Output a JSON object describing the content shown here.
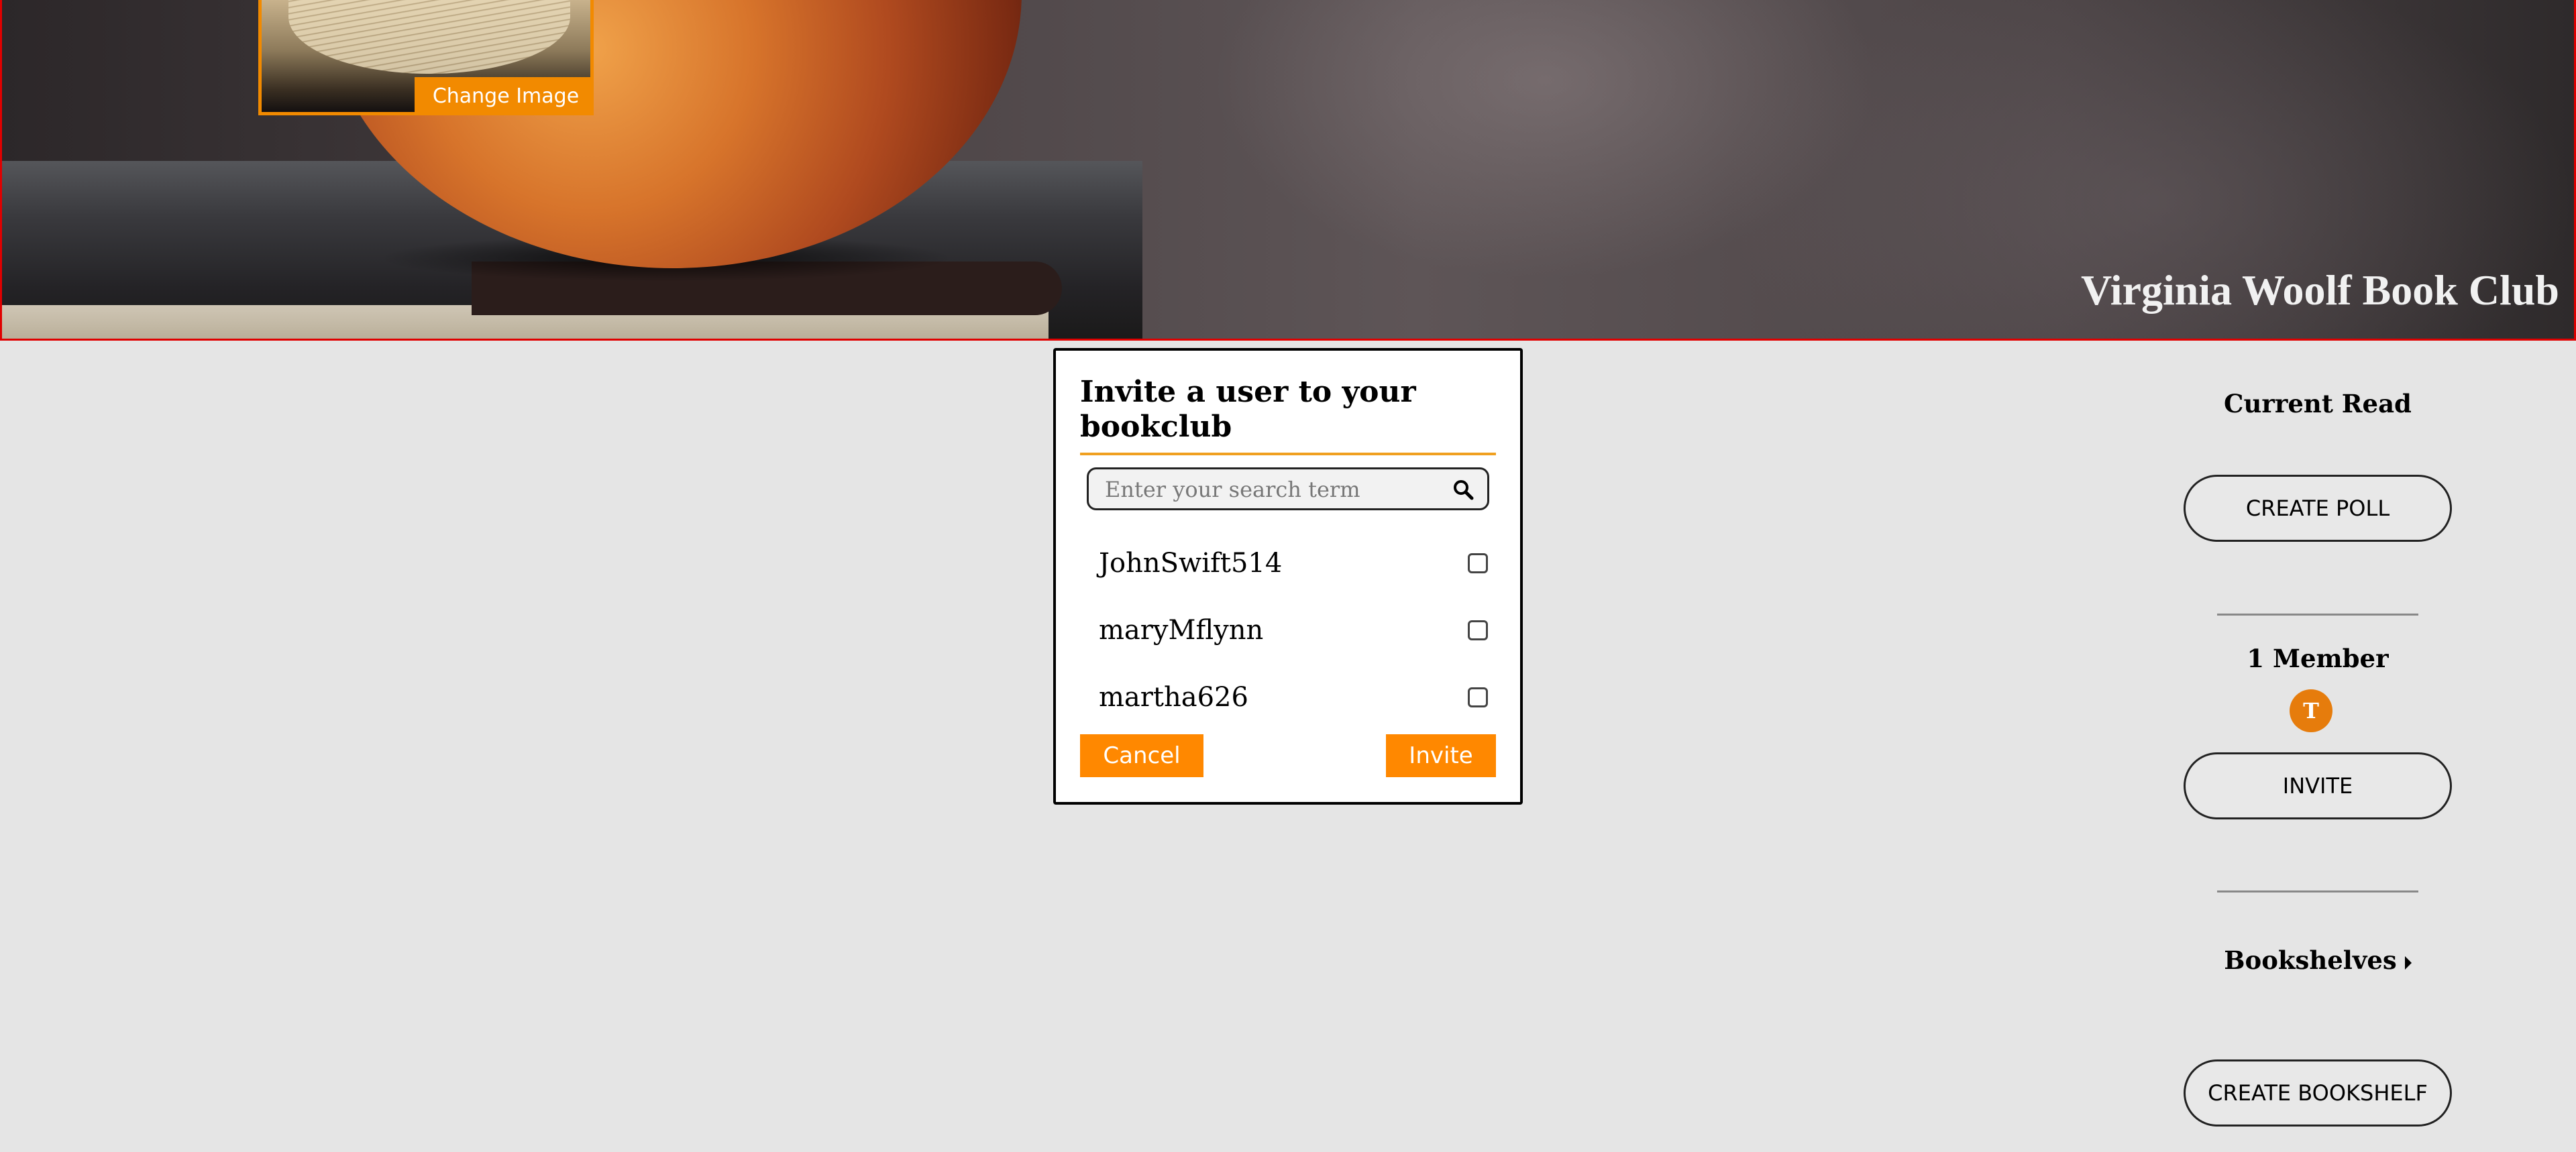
{
  "banner": {
    "club_name": "Virginia Woolf Book Club",
    "change_image_label": "Change Image"
  },
  "invite_modal": {
    "title": "Invite a user to your bookclub",
    "search": {
      "placeholder": "Enter your search term",
      "value": ""
    },
    "users": [
      {
        "username": "JohnSwift514",
        "checked": false
      },
      {
        "username": "maryMflynn",
        "checked": false
      },
      {
        "username": "martha626",
        "checked": false
      }
    ],
    "cancel_label": "Cancel",
    "invite_label": "Invite"
  },
  "sidebar": {
    "current_read_heading": "Current Read",
    "create_poll_label": "CREATE POLL",
    "members_heading": "1 Member",
    "member_avatars": [
      {
        "initial": "T",
        "color": "#e67c0c"
      }
    ],
    "invite_label": "INVITE",
    "bookshelves_heading": "Bookshelves",
    "create_bookshelf_label": "CREATE BOOKSHELF"
  },
  "colors": {
    "accent": "#ff8800",
    "banner_border": "#e00000",
    "page_background": "#e5e5e5"
  },
  "icons": [
    "search-icon",
    "caret-right-icon"
  ]
}
